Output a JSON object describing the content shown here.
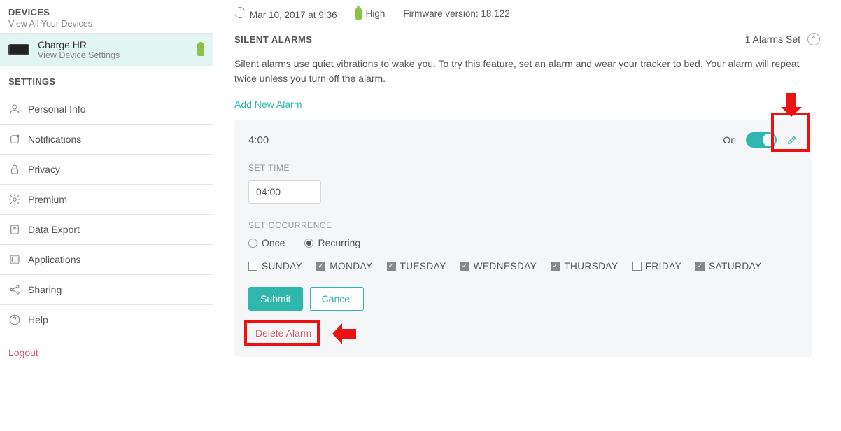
{
  "sidebar": {
    "devices_title": "DEVICES",
    "devices_sub": "View All Your Devices",
    "device_name": "Charge HR",
    "device_sub": "View Device Settings",
    "settings_title": "SETTINGS",
    "items": [
      {
        "label": "Personal Info"
      },
      {
        "label": "Notifications"
      },
      {
        "label": "Privacy"
      },
      {
        "label": "Premium"
      },
      {
        "label": "Data Export"
      },
      {
        "label": "Applications"
      },
      {
        "label": "Sharing"
      },
      {
        "label": "Help"
      }
    ],
    "logout": "Logout"
  },
  "status": {
    "sync": "Mar 10, 2017 at 9:36",
    "battery": "High",
    "firmware_label": "Firmware version:",
    "firmware_value": "18.122"
  },
  "section": {
    "title": "SILENT ALARMS",
    "alarms_set": "1 Alarms Set",
    "desc": "Silent alarms use quiet vibrations to wake you. To try this feature, set an alarm and wear your tracker to bed. Your alarm will repeat twice unless you turn off the alarm.",
    "add_link": "Add New Alarm"
  },
  "alarm": {
    "display_time": "4:00",
    "toggle_label": "On",
    "set_time_label": "SET TIME",
    "time_value": "04:00",
    "set_occurrence_label": "SET OCCURRENCE",
    "occurrence": {
      "once_label": "Once",
      "recurring_label": "Recurring",
      "selected": "recurring"
    },
    "days": [
      {
        "label": "SUNDAY",
        "checked": false
      },
      {
        "label": "MONDAY",
        "checked": true
      },
      {
        "label": "TUESDAY",
        "checked": true
      },
      {
        "label": "WEDNESDAY",
        "checked": true
      },
      {
        "label": "THURSDAY",
        "checked": true
      },
      {
        "label": "FRIDAY",
        "checked": false
      },
      {
        "label": "SATURDAY",
        "checked": true
      }
    ],
    "submit": "Submit",
    "cancel": "Cancel",
    "delete": "Delete Alarm"
  },
  "colors": {
    "accent": "#2fb6ad",
    "danger": "#d0576d",
    "highlight": "#e11"
  }
}
